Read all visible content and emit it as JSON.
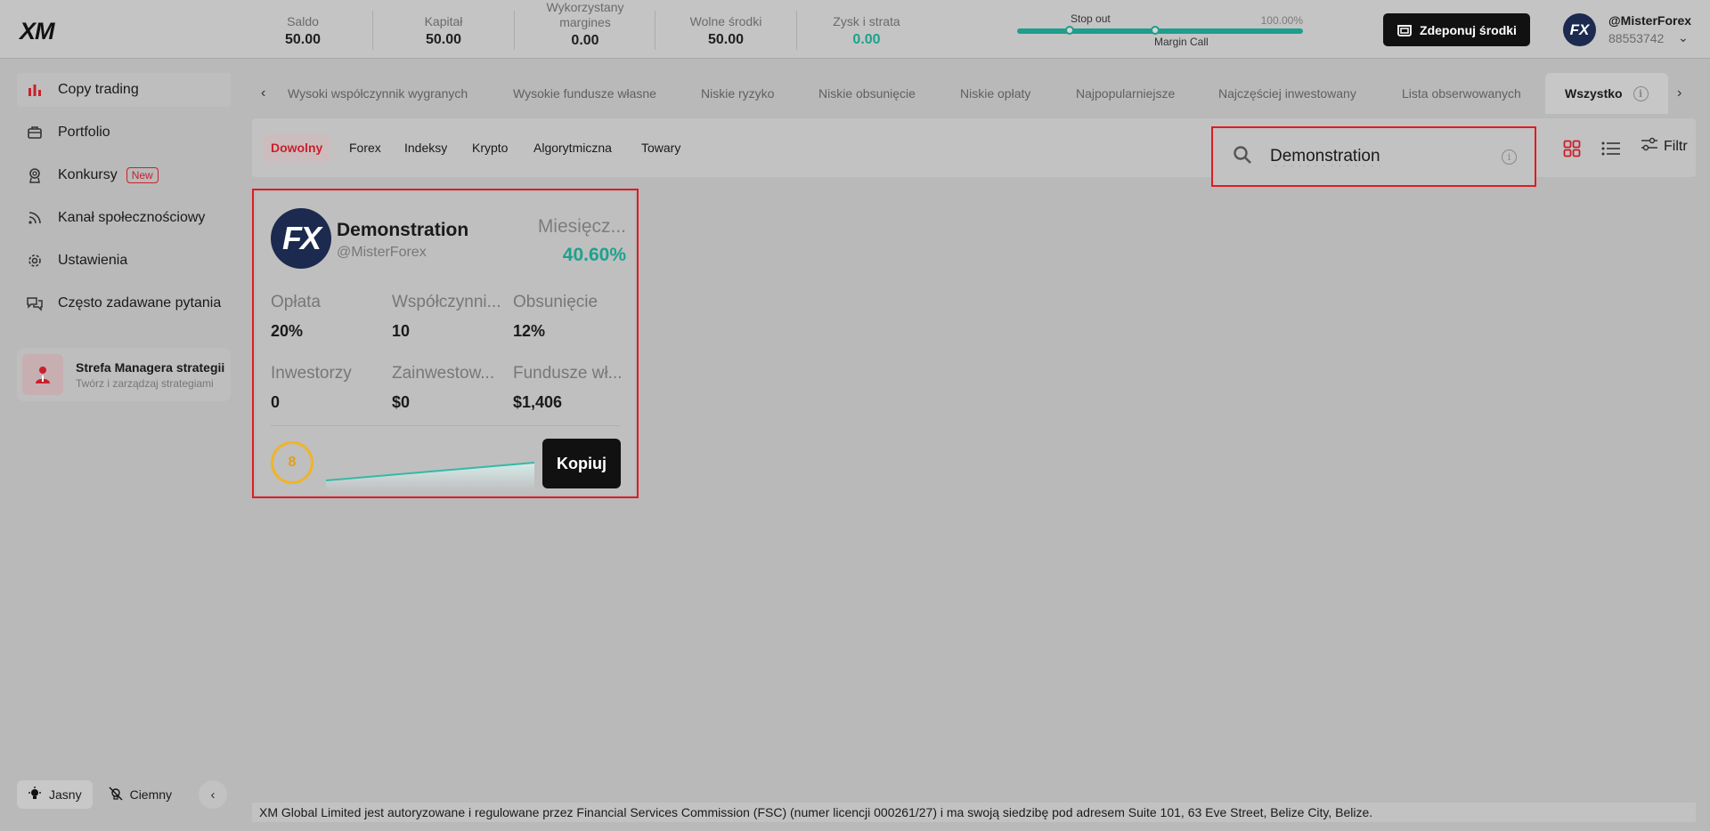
{
  "header": {
    "logo": "XM",
    "stats": [
      {
        "label": "Saldo",
        "value": "50.00"
      },
      {
        "label": "Kapitał",
        "value": "50.00"
      },
      {
        "label": "Wykorzystany margines",
        "value": "0.00"
      },
      {
        "label": "Wolne środki",
        "value": "50.00"
      },
      {
        "label": "Zysk i strata",
        "value": "0.00"
      }
    ],
    "margin": {
      "stop_out": "Stop out",
      "percent": "100.00%",
      "margin_call": "Margin Call",
      "level": 1.0
    },
    "deposit_button": "Zdeponuj środki",
    "user": {
      "avatar": "FX",
      "name": "@MisterForex",
      "id": "88553742"
    }
  },
  "sidebar": {
    "items": [
      {
        "label": "Copy trading",
        "icon": "bar-chart-icon"
      },
      {
        "label": "Portfolio",
        "icon": "briefcase-icon"
      },
      {
        "label": "Konkursy",
        "icon": "award-icon",
        "badge": "New"
      },
      {
        "label": "Kanał społecznościowy",
        "icon": "rss-icon"
      },
      {
        "label": "Ustawienia",
        "icon": "gear-icon"
      },
      {
        "label": "Często zadawane pytania",
        "icon": "chat-icon"
      }
    ],
    "manager": {
      "title": "Strefa Managera strategii",
      "subtitle": "Twórz i zarządzaj strategiami"
    },
    "theme": {
      "light": "Jasny",
      "dark": "Ciemny"
    }
  },
  "tabs": [
    "Wysoki współczynnik wygranych",
    "Wysokie fundusze własne",
    "Niskie ryzyko",
    "Niskie obsunięcie",
    "Niskie opłaty",
    "Najpopularniejsze",
    "Najczęściej inwestowany",
    "Lista obserwowanych",
    "Wszystko"
  ],
  "markets": [
    "Dowolny",
    "Forex",
    "Indeksy",
    "Krypto",
    "Algorytmiczna",
    "Towary"
  ],
  "search": {
    "value": "Demonstration",
    "placeholder": ""
  },
  "filter_label": "Filtr",
  "card": {
    "avatar": "FX",
    "name": "Demonstration",
    "handle": "@MisterForex",
    "period_label": "Miesięcz...",
    "return": "40.60%",
    "metrics": [
      {
        "label": "Opłata",
        "value": "20%"
      },
      {
        "label": "Współczynni...",
        "value": "10"
      },
      {
        "label": "Obsunięcie",
        "value": "12%"
      },
      {
        "label": "Inwestorzy",
        "value": "0"
      },
      {
        "label": "Zainwestow...",
        "value": "$0"
      },
      {
        "label": "Fundusze wł...",
        "value": "$1,406"
      }
    ],
    "risk": "8",
    "copy_button": "Kopiuj"
  },
  "footer": "XM Global Limited jest autoryzowane i regulowane przez Financial Services Commission (FSC) (numer licencji 000261/27) i ma swoją siedzibę pod adresem Suite 101, 63 Eve Street, Belize City, Belize.",
  "colors": {
    "accent_red": "#c9202c",
    "teal": "#1ea18e",
    "risk_yellow": "#f0b429"
  }
}
